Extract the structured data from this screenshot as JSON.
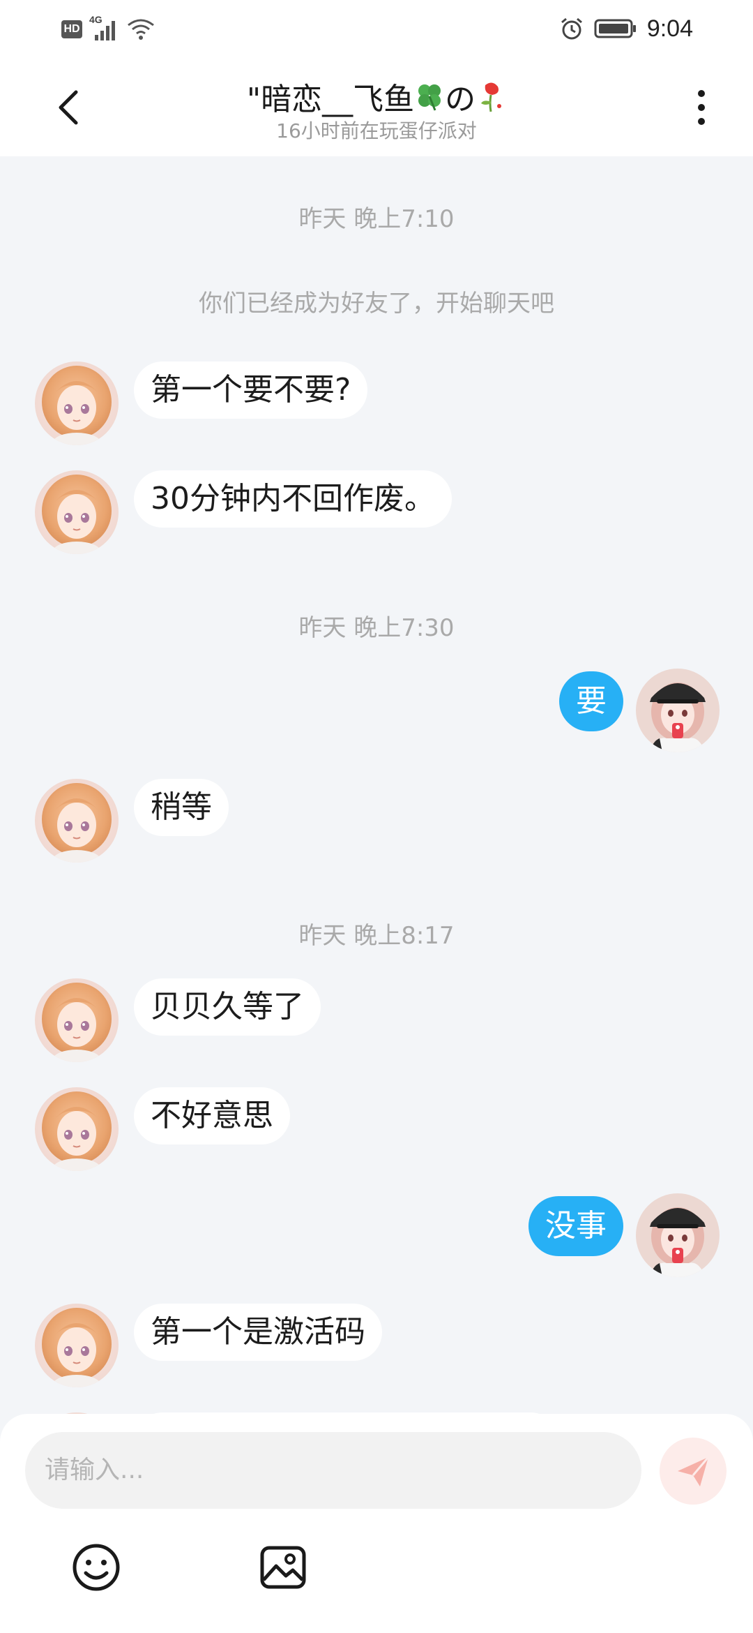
{
  "status_bar": {
    "network_badge": "HD",
    "network_type": "4G",
    "time": "9:04",
    "icons": [
      "hd-icon",
      "signal-icon",
      "wifi-icon",
      "alarm-icon",
      "battery-icon"
    ]
  },
  "header": {
    "title_prefix": "\"暗恋__飞鱼",
    "title_mid": "の",
    "subtitle": "16小时前在玩蛋仔派对",
    "icons": [
      "back-arrow-icon",
      "clover-emoji-icon",
      "wilted-rose-emoji-icon",
      "more-vertical-icon"
    ]
  },
  "chat": {
    "timestamps": [
      "昨天 晚上7:10",
      "昨天 晚上7:30",
      "昨天 晚上8:17"
    ],
    "system_note": "你们已经成为好友了，开始聊天吧",
    "messages": [
      {
        "from": "them",
        "text": "第一个要不要?"
      },
      {
        "from": "them",
        "text": "30分钟内不回作废。"
      },
      {
        "from": "me",
        "text": "要"
      },
      {
        "from": "them",
        "text": "稍等"
      },
      {
        "from": "them",
        "text": "贝贝久等了"
      },
      {
        "from": "them",
        "text": "不好意思"
      },
      {
        "from": "me",
        "text": "没事"
      },
      {
        "from": "them",
        "text": "第一个是激活码"
      }
    ]
  },
  "composer": {
    "placeholder": "请输入...",
    "icons": [
      "send-icon",
      "emoji-icon",
      "image-icon"
    ]
  },
  "colors": {
    "chat_background": "#f3f5f8",
    "outgoing_bubble": "#27b0f5",
    "incoming_bubble": "#ffffff",
    "send_button_background": "#fdecea",
    "send_icon": "#f6b0a8"
  }
}
